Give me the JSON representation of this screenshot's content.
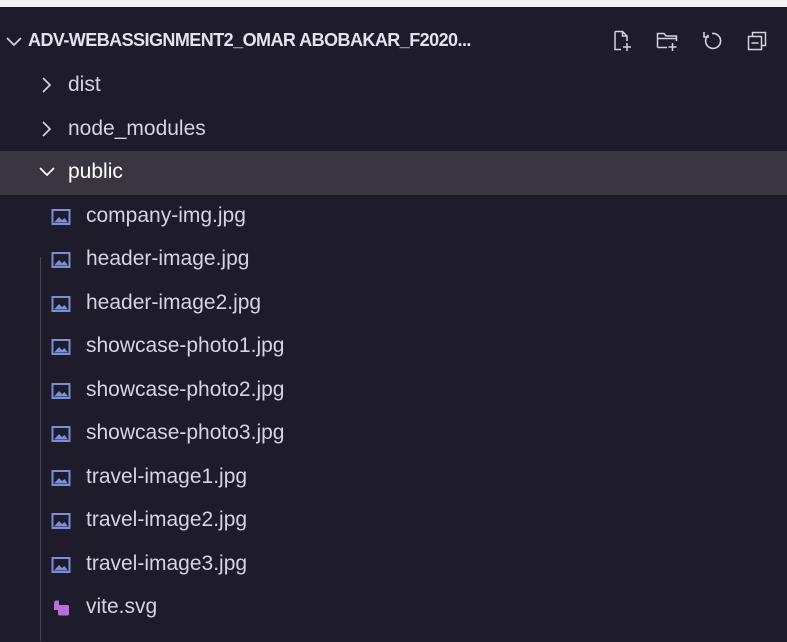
{
  "explorer": {
    "root_title": "ADV-WEBASSIGNMENT2_OMAR ABOBAKAR_F2020...",
    "actions": [
      {
        "name": "new-file",
        "icon": "new-file-icon"
      },
      {
        "name": "new-folder",
        "icon": "new-folder-icon"
      },
      {
        "name": "refresh",
        "icon": "refresh-icon"
      },
      {
        "name": "collapse-all",
        "icon": "collapse-all-icon"
      }
    ],
    "folders": [
      {
        "label": "dist",
        "expanded": false
      },
      {
        "label": "node_modules",
        "expanded": false
      },
      {
        "label": "public",
        "expanded": true,
        "selected": true
      }
    ],
    "files": [
      {
        "label": "company-img.jpg",
        "icon": "image-file-icon"
      },
      {
        "label": "header-image.jpg",
        "icon": "image-file-icon"
      },
      {
        "label": "header-image2.jpg",
        "icon": "image-file-icon"
      },
      {
        "label": "showcase-photo1.jpg",
        "icon": "image-file-icon"
      },
      {
        "label": "showcase-photo2.jpg",
        "icon": "image-file-icon"
      },
      {
        "label": "showcase-photo3.jpg",
        "icon": "image-file-icon"
      },
      {
        "label": "travel-image1.jpg",
        "icon": "image-file-icon"
      },
      {
        "label": "travel-image2.jpg",
        "icon": "image-file-icon"
      },
      {
        "label": "travel-image3.jpg",
        "icon": "image-file-icon"
      },
      {
        "label": "vite.svg",
        "icon": "svg-file-icon"
      }
    ],
    "colors": {
      "background": "#1e1b2a",
      "selected_row": "#393641",
      "image_icon": "#7b8fd6",
      "svg_icon": "#b56fd6"
    }
  }
}
